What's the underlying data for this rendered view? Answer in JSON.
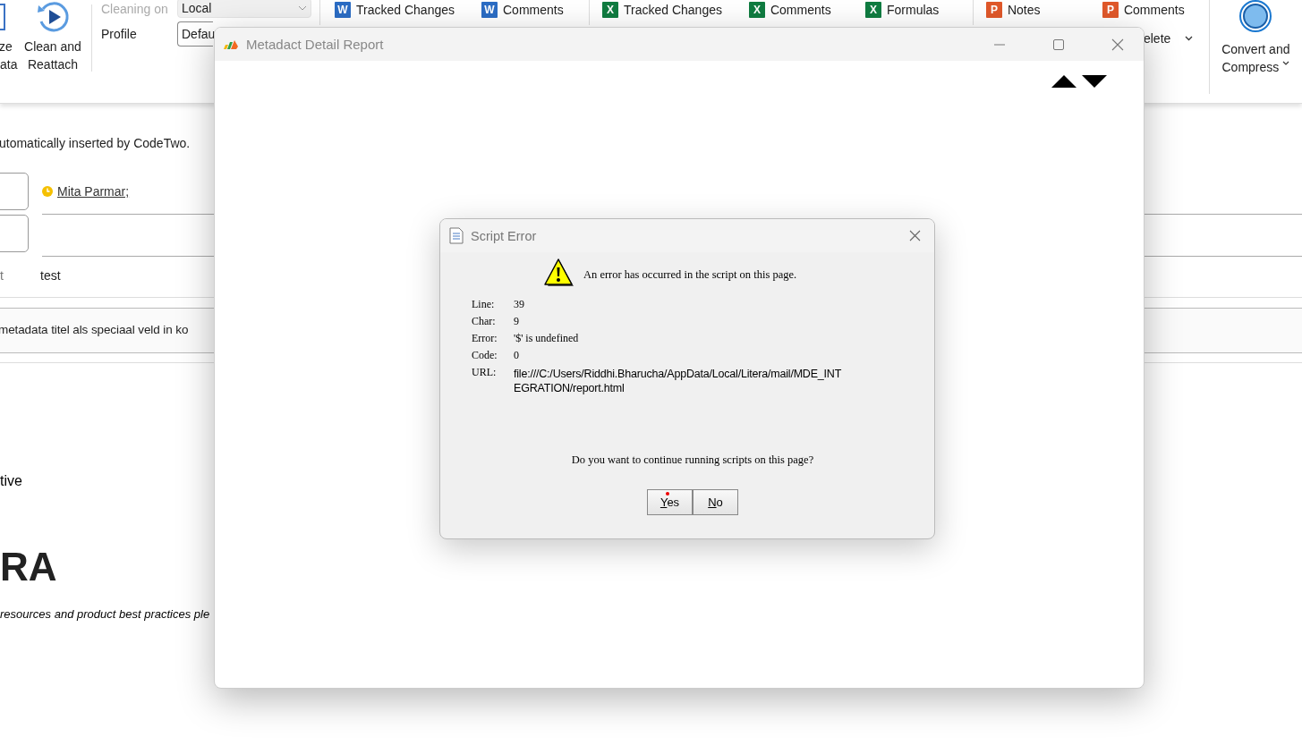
{
  "ribbon": {
    "partial_button": {
      "label_lines": [
        "ze",
        "ata"
      ]
    },
    "clean_button": {
      "label_lines": [
        "Clean and",
        "Reattach"
      ]
    },
    "settings": [
      {
        "label": "Cleaning on",
        "value": "Local",
        "disabled": true
      },
      {
        "label": "Profile",
        "value": "Defau",
        "disabled": false
      }
    ],
    "groups": [
      {
        "items": [
          {
            "kind": "word",
            "badge": "W",
            "label": "Tracked Changes"
          },
          {
            "kind": "word",
            "badge": "W",
            "label": "Comments"
          }
        ]
      },
      {
        "items": [
          {
            "kind": "excel",
            "badge": "X",
            "label": "Tracked Changes"
          },
          {
            "kind": "excel",
            "badge": "X",
            "label": "Comments"
          },
          {
            "kind": "excel",
            "badge": "X",
            "label": "Formulas"
          }
        ]
      },
      {
        "items": [
          {
            "kind": "powerpoint",
            "badge": "P",
            "label": "Notes"
          },
          {
            "kind": "powerpoint",
            "badge": "P",
            "label": "Comments"
          }
        ],
        "menu": "elete"
      }
    ],
    "convert_button": {
      "label_lines": [
        "Convert and",
        "Compress"
      ]
    }
  },
  "email": {
    "notice": "utomatically inserted by CodeTwo.",
    "recipient": "Mita Parmar;",
    "field_label": "t",
    "field_value": "test",
    "subject": "metadata titel als speciaal veld in ko",
    "body_text": "tive",
    "logo": "RA",
    "footer": "resources and product best practices ple"
  },
  "report_window": {
    "title": "Metadact Detail Report"
  },
  "dialog": {
    "title": "Script Error",
    "message": "An error has occurred in the script on this page.",
    "details": [
      {
        "label": "Line:",
        "value": "39",
        "kind": "text"
      },
      {
        "label": "Char:",
        "value": "9",
        "kind": "text"
      },
      {
        "label": "Error:",
        "value": "'$' is undefined",
        "kind": "text"
      },
      {
        "label": "Code:",
        "value": "0",
        "kind": "text"
      },
      {
        "label": "URL:",
        "value": "file:///C:/Users/Riddhi.Bharucha/AppData/Local/Litera/mail/MDE_INTEGRATION/report.html",
        "kind": "url"
      }
    ],
    "question": "Do you want to continue running scripts on this page?",
    "buttons": [
      {
        "label": "Yes",
        "marked": true
      },
      {
        "label": "No",
        "marked": false
      }
    ]
  }
}
